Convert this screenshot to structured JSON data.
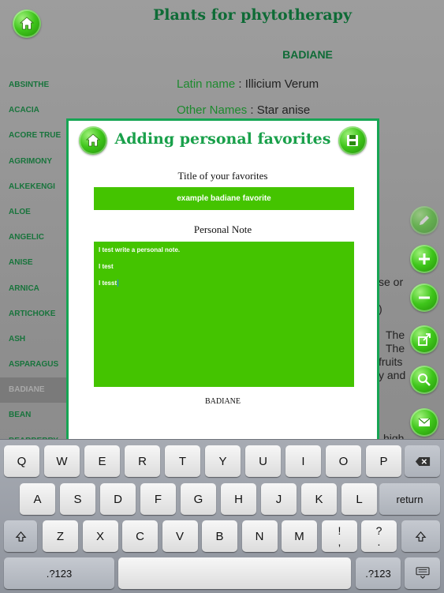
{
  "app": {
    "title": "Plants for phytotherapy"
  },
  "plant": {
    "heading": "BADIANE",
    "latin_label": "Latin name",
    "latin_value": "Illicium Verum",
    "other_label": "Other Names",
    "other_value": "Star anise",
    "background_fragments": [
      "se or",
      ")",
      "The",
      "The",
      "fruits",
      "y and",
      "high"
    ]
  },
  "sidebar": {
    "items": [
      {
        "label": "ABSINTHE"
      },
      {
        "label": "ACACIA"
      },
      {
        "label": "ACORE TRUE"
      },
      {
        "label": "AGRIMONY"
      },
      {
        "label": "ALKEKENGI"
      },
      {
        "label": "ALOE"
      },
      {
        "label": "ANGELIC"
      },
      {
        "label": "ANISE"
      },
      {
        "label": "ARNICA"
      },
      {
        "label": "ARTICHOKE"
      },
      {
        "label": "ASH"
      },
      {
        "label": "ASPARAGUS"
      },
      {
        "label": "BADIANE"
      },
      {
        "label": "BEAN"
      },
      {
        "label": "BEARBERRY"
      }
    ],
    "selected": "BADIANE"
  },
  "modal": {
    "title": "Adding personal favorites",
    "title_label": "Title of your favorites",
    "title_value": "example badiane favorite",
    "note_label": "Personal Note",
    "note_lines": [
      "I test write a personal note.",
      "I test",
      "I tesst"
    ],
    "plant_name": "BADIANE"
  },
  "right_actions": [
    {
      "icon": "pencil-icon"
    },
    {
      "icon": "plus-icon"
    },
    {
      "icon": "minus-icon"
    },
    {
      "icon": "share-icon"
    },
    {
      "icon": "magnifier-icon"
    },
    {
      "icon": "mail-icon"
    }
  ],
  "keyboard": {
    "row1": [
      "Q",
      "W",
      "E",
      "R",
      "T",
      "Y",
      "U",
      "I",
      "O",
      "P"
    ],
    "row2": [
      "A",
      "S",
      "D",
      "F",
      "G",
      "H",
      "J",
      "K",
      "L"
    ],
    "row3": [
      "Z",
      "X",
      "C",
      "V",
      "B",
      "N",
      "M"
    ],
    "return_label": "return",
    "num_label": ".?123",
    "excl": [
      "!",
      ","
    ],
    "quest": [
      "?",
      "."
    ]
  },
  "colors": {
    "accent": "#44c400",
    "title_green": "#0e6b36",
    "border": "#17a554"
  }
}
